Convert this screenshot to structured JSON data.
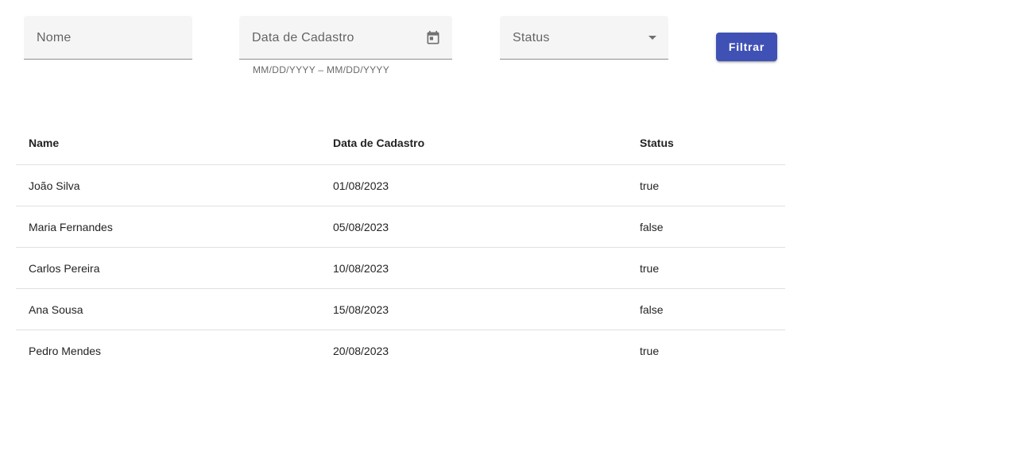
{
  "filters": {
    "nome_placeholder": "Nome",
    "data_placeholder": "Data de Cadastro",
    "data_hint": "MM/DD/YYYY – MM/DD/YYYY",
    "status_placeholder": "Status",
    "filter_button_label": "Filtrar",
    "calendar_icon": "calendar-icon",
    "dropdown_icon": "dropdown-arrow-icon"
  },
  "table": {
    "columns": [
      "Name",
      "Data de Cadastro",
      "Status"
    ],
    "rows": [
      [
        "João Silva",
        "01/08/2023",
        "true"
      ],
      [
        "Maria Fernandes",
        "05/08/2023",
        "false"
      ],
      [
        "Carlos Pereira",
        "10/08/2023",
        "true"
      ],
      [
        "Ana Sousa",
        "15/08/2023",
        "false"
      ],
      [
        "Pedro Mendes",
        "20/08/2023",
        "true"
      ]
    ]
  },
  "colors": {
    "primary": "#3f51b5",
    "field_background": "#f5f5f5"
  }
}
